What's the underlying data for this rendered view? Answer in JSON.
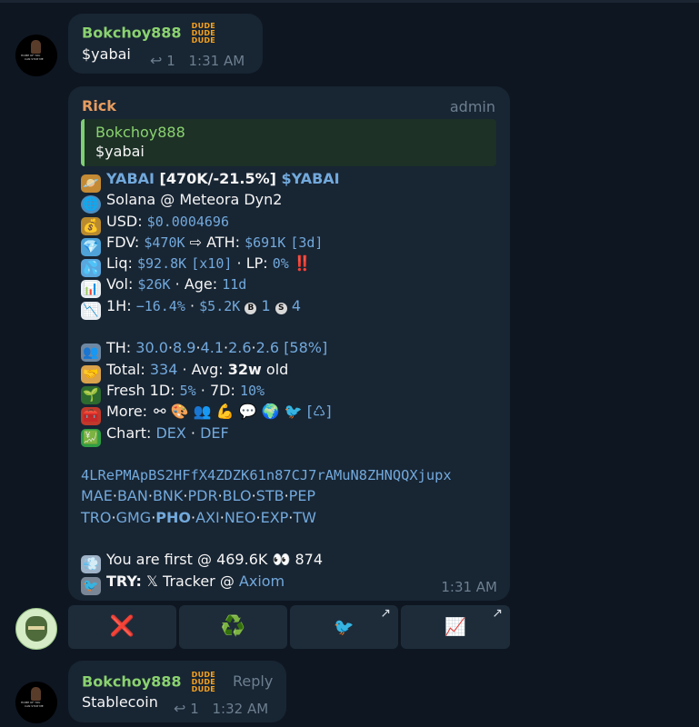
{
  "colors": {
    "background": "#0e1621",
    "bubble": "#182533",
    "accent": "#72a9dc",
    "name_green": "#8ad26f",
    "name_orange": "#e79d5f",
    "meta": "#6d7f8f"
  },
  "msg1": {
    "sender": "Bokchoy888",
    "badge": [
      "DUDE",
      "DUDE",
      "DUDE"
    ],
    "text": "$yabai",
    "replies": "1",
    "time": "1:31 AM"
  },
  "msg2": {
    "sender": "Rick",
    "role": "admin",
    "quote": {
      "sender": "Bokchoy888",
      "text": "$yabai"
    },
    "l1": {
      "name": "YABAI",
      "stats": " [470K/-21.5%] ",
      "ticker": "$YABAI"
    },
    "l2": {
      "text": "Solana @ Meteora Dyn2"
    },
    "l3": {
      "label": "USD: ",
      "value": "$0.0004696"
    },
    "l4": {
      "label": "FDV: ",
      "fdv": "$470K",
      "arrow": " ⇨ ",
      "ath_label": "ATH: ",
      "ath": "$691K",
      "ath_age": "[3d]"
    },
    "l5": {
      "label": "Liq: ",
      "value": "$92.8K",
      "mult": "[x10]",
      "sep": " · ",
      "lp_label": "LP: ",
      "lp": "0%",
      "alert": "‼️"
    },
    "l6": {
      "label": "Vol: ",
      "vol": "$26K",
      "sep": " · ",
      "age_label": "Age: ",
      "age": "11d"
    },
    "l7": {
      "label": "1H: ",
      "change": "−16.4%",
      "sep": " · ",
      "amount": "$5.2K",
      "b_icon": "B",
      "buys": "1",
      "s_icon": "S",
      "sells": "4"
    },
    "l8": {
      "label": "TH: ",
      "v1": "30.0",
      "v2": "8.9",
      "v3": "4.1",
      "v4": "2.6",
      "v5": "2.6",
      "pct": "[58%]"
    },
    "l9": {
      "label": "Total: ",
      "total": "334",
      "sep": " · ",
      "avg_label": "Avg: ",
      "avg": "32w",
      "avg_suffix": " old"
    },
    "l10": {
      "label": "Fresh 1D: ",
      "d1": "5%",
      "sep": " · ",
      "d7_label": "7D: ",
      "d7": "10%"
    },
    "l11": {
      "label": "More: ",
      "tail": "[♺]"
    },
    "l12": {
      "label": "Chart: ",
      "dex": "DEX",
      "sep": " · ",
      "def": "DEF"
    },
    "address": "4LRePMApBS2HFfX4ZDZK61n87CJ7rAMuN8ZHNQQXjupx",
    "links1": [
      "MAE",
      "BAN",
      "BNK",
      "PDR",
      "BLO",
      "STB",
      "PEP"
    ],
    "links2": [
      "TRO",
      "GMG",
      "PHO",
      "AXI",
      "NEO",
      "EXP",
      "TW"
    ],
    "l13": {
      "text": "You are first @ 469.6K ",
      "count": " 874"
    },
    "l14": {
      "label": "TRY:",
      "tracker": " 𝕏 Tracker @ ",
      "axiom": "Axiom"
    },
    "time": "1:31 AM"
  },
  "buttons": [
    {
      "icon": "close-icon",
      "glyph": "❌"
    },
    {
      "icon": "recycle-icon",
      "glyph": "♻️"
    },
    {
      "icon": "bird-icon",
      "glyph": "🐦",
      "corner": "↗"
    },
    {
      "icon": "chart-up-icon",
      "glyph": "📈",
      "corner": "↗"
    }
  ],
  "msg3": {
    "sender": "Bokchoy888",
    "badge": [
      "DUDE",
      "DUDE",
      "DUDE"
    ],
    "reply_label": "Reply",
    "text": "Stablecoin",
    "replies": "1",
    "time": "1:32 AM"
  },
  "avatar_text": {
    "l1": "HOME OF YOU",
    "l2": "CAN STOP ME"
  }
}
